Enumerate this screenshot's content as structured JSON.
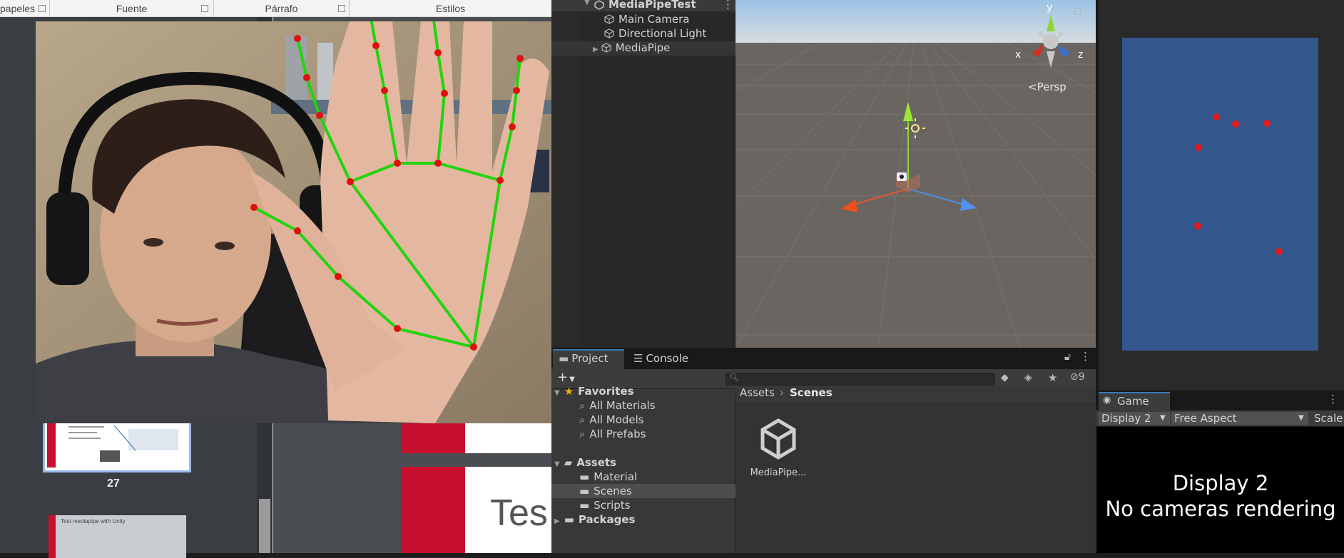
{
  "ppt": {
    "ribbon_groups": [
      "papeles",
      "Fuente",
      "Párrafo",
      "Estilos"
    ],
    "thumb27_number": "27",
    "thumb28_title": "Test mediapipe with Unity",
    "slide_text": "Tes"
  },
  "hierarchy": {
    "scene_name": "MediaPipeTest",
    "items": [
      {
        "label": "Main Camera"
      },
      {
        "label": "Directional Light"
      },
      {
        "label": "MediaPipe"
      }
    ]
  },
  "scene_view": {
    "gizmo_labels": {
      "y": "y",
      "x": "x",
      "z": "z"
    },
    "projection_label": "Persp"
  },
  "project": {
    "tabs": [
      "Project",
      "Console"
    ],
    "hidden_count": "9",
    "search_placeholder": "",
    "favorites": {
      "label": "Favorites",
      "items": [
        "All Materials",
        "All Models",
        "All Prefabs"
      ]
    },
    "assets": {
      "label": "Assets",
      "items": [
        "Material",
        "Scenes",
        "Scripts"
      ],
      "selected": "Scenes"
    },
    "packages_label": "Packages",
    "breadcrumb": [
      "Assets",
      "Scenes"
    ],
    "asset_files": [
      {
        "name": "MediaPipe..."
      }
    ]
  },
  "game": {
    "tab_label": "Game",
    "display": "Display 2",
    "aspect": "Free Aspect",
    "scale_label": "Scale",
    "message_line1": "Display 2",
    "message_line2": "No cameras rendering"
  },
  "colors": {
    "unity_selection": "#3a79bb",
    "landmark_red": "#e01010",
    "skeleton_green": "#22d40e",
    "game_background": "#33568c"
  }
}
